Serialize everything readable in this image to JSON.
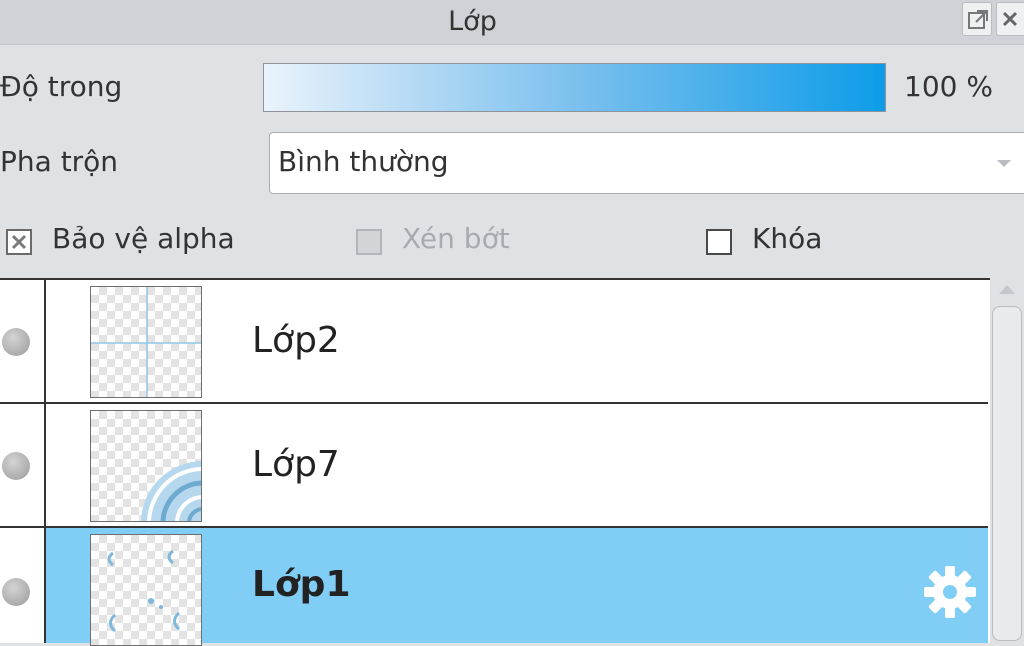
{
  "panel": {
    "title": "Lớp"
  },
  "opacity": {
    "label": "Độ trong",
    "value_text": "100 %",
    "fraction": 1.0
  },
  "blend": {
    "label": "Pha trộn",
    "value": "Bình thường"
  },
  "options": {
    "protect_alpha": {
      "label": "Bảo vệ alpha",
      "checked": true,
      "enabled": true
    },
    "clip": {
      "label": "Xén bớt",
      "checked": false,
      "enabled": false
    },
    "lock": {
      "label": "Khóa",
      "checked": false,
      "enabled": true
    }
  },
  "layers": [
    {
      "name": "Lớp2",
      "selected": false,
      "thumbnail": "crosshair-guides"
    },
    {
      "name": "Lớp7",
      "selected": false,
      "thumbnail": "blue-ripple-corner"
    },
    {
      "name": "Lớp1",
      "selected": true,
      "thumbnail": "blue-scribbles"
    }
  ],
  "colors": {
    "selected_row": "#80cef5",
    "accent_blue": "#0d9ce8"
  }
}
